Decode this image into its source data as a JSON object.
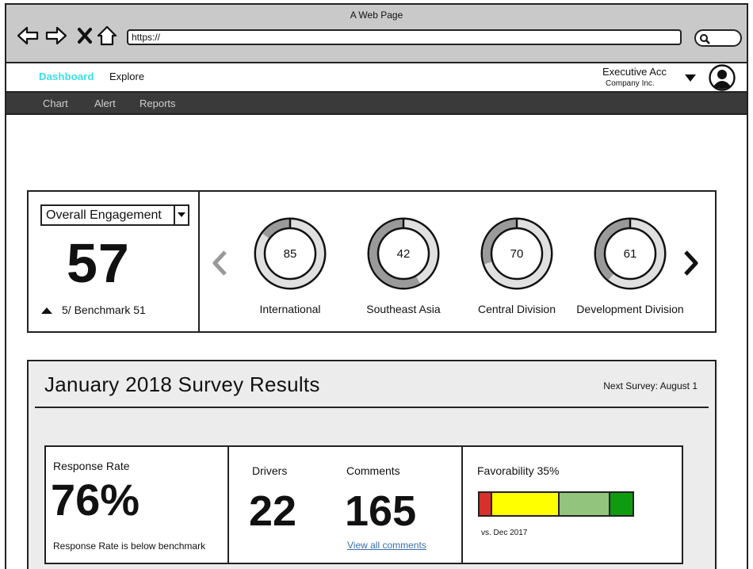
{
  "browser": {
    "window_title": "A Web Page",
    "url": "https://",
    "icons": [
      "back-arrow-icon",
      "forward-arrow-icon",
      "close-x-icon",
      "home-icon",
      "search-icon"
    ]
  },
  "topnav": {
    "brand_link": "Dashboard",
    "explore_link": "Explore",
    "account_name": "Executive Acc",
    "account_company": "Company Inc.",
    "brand_color": "#38e0e8"
  },
  "subnav": {
    "items": [
      {
        "label": "Chart"
      },
      {
        "label": "Alert"
      },
      {
        "label": "Reports"
      }
    ]
  },
  "engagement": {
    "selected_metric": "Overall Engagement",
    "score": "57",
    "benchmark_text": "5/ Benchmark 51",
    "divisions": [
      {
        "value": 85,
        "label": "International"
      },
      {
        "value": 42,
        "label": "Southeast Asia"
      },
      {
        "value": 70,
        "label": "Central Division"
      },
      {
        "value": 61,
        "label": "Development Division"
      }
    ]
  },
  "survey": {
    "title": "January 2018 Survey Results",
    "next_survey": "Next Survey: August 1",
    "response_rate_label": "Response Rate",
    "response_rate_value": "76%",
    "response_rate_note": "Response Rate is below benchmark",
    "drivers_label": "Drivers",
    "drivers_value": "22",
    "comments_label": "Comments",
    "comments_value": "165",
    "comments_link": "View all comments",
    "favorability_label": "Favorability 35%",
    "favorability_note": "vs. Dec 2017",
    "favorability_segments": [
      {
        "share": 0.085,
        "color": "#d8302a"
      },
      {
        "share": 0.44,
        "color": "#ffff00"
      },
      {
        "share": 0.33,
        "color": "#93c47d"
      },
      {
        "share": 0.145,
        "color": "#0f9b0f"
      }
    ]
  }
}
